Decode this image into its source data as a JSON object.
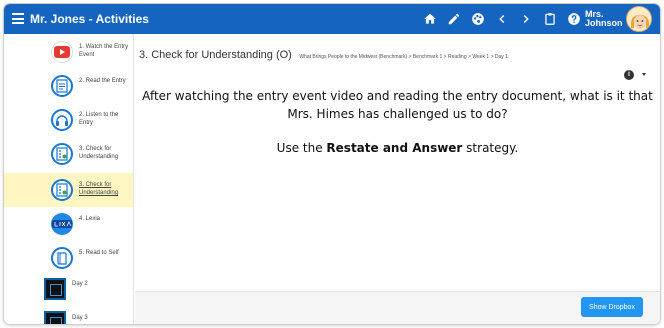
{
  "app": {
    "title": "Mr. Jones - Activities"
  },
  "user": {
    "name_line1": "Mrs.",
    "name_line2": "Johnson"
  },
  "toolbar_icons": [
    "home-icon",
    "pencil-icon",
    "palette-icon",
    "chevron-left-icon",
    "chevron-right-icon",
    "clipboard-icon",
    "help-icon"
  ],
  "sidebar": {
    "items": [
      {
        "label": "1. Watch the Entry Event",
        "icon": "video-icon",
        "icon_color": "#e53935"
      },
      {
        "label": "2. Read the Entry",
        "icon": "document-icon",
        "icon_color": "#1976d2"
      },
      {
        "label": "2. Listen to the Entry",
        "icon": "headphones-icon",
        "icon_color": "#1976d2"
      },
      {
        "label": "3. Check for Understanding",
        "icon": "checklist-icon",
        "icon_color": "#1976d2"
      },
      {
        "label": "3. Check for Understanding",
        "icon": "checklist-icon",
        "icon_color": "#1976d2",
        "active": true
      },
      {
        "label": "4. Lexia",
        "icon": "lexia-icon",
        "icon_color": "#1e88e5"
      },
      {
        "label": "5. Read to Self",
        "icon": "book-icon",
        "icon_color": "#1976d2"
      }
    ],
    "days": [
      {
        "label": "Day 2"
      },
      {
        "label": "Day 3"
      }
    ]
  },
  "content": {
    "title": "3. Check for Understanding (O)",
    "breadcrumb": "What Brings People to the Midwest (Benchmark) > Benchmark 1 > Reading > Week 1 > Day 1",
    "info_label": "i",
    "question": "After watching the entry event video and reading the entry document, what is it that Mrs. Himes has challenged us to do?",
    "strategy_prefix": "Use the ",
    "strategy_name": "Restate and Answer",
    "strategy_suffix": " strategy."
  },
  "footer": {
    "button_label": "Show Dropbox"
  },
  "colors": {
    "topbar": "#1565c0",
    "active_item": "#fff6c2",
    "primary_button": "#2196f3"
  }
}
